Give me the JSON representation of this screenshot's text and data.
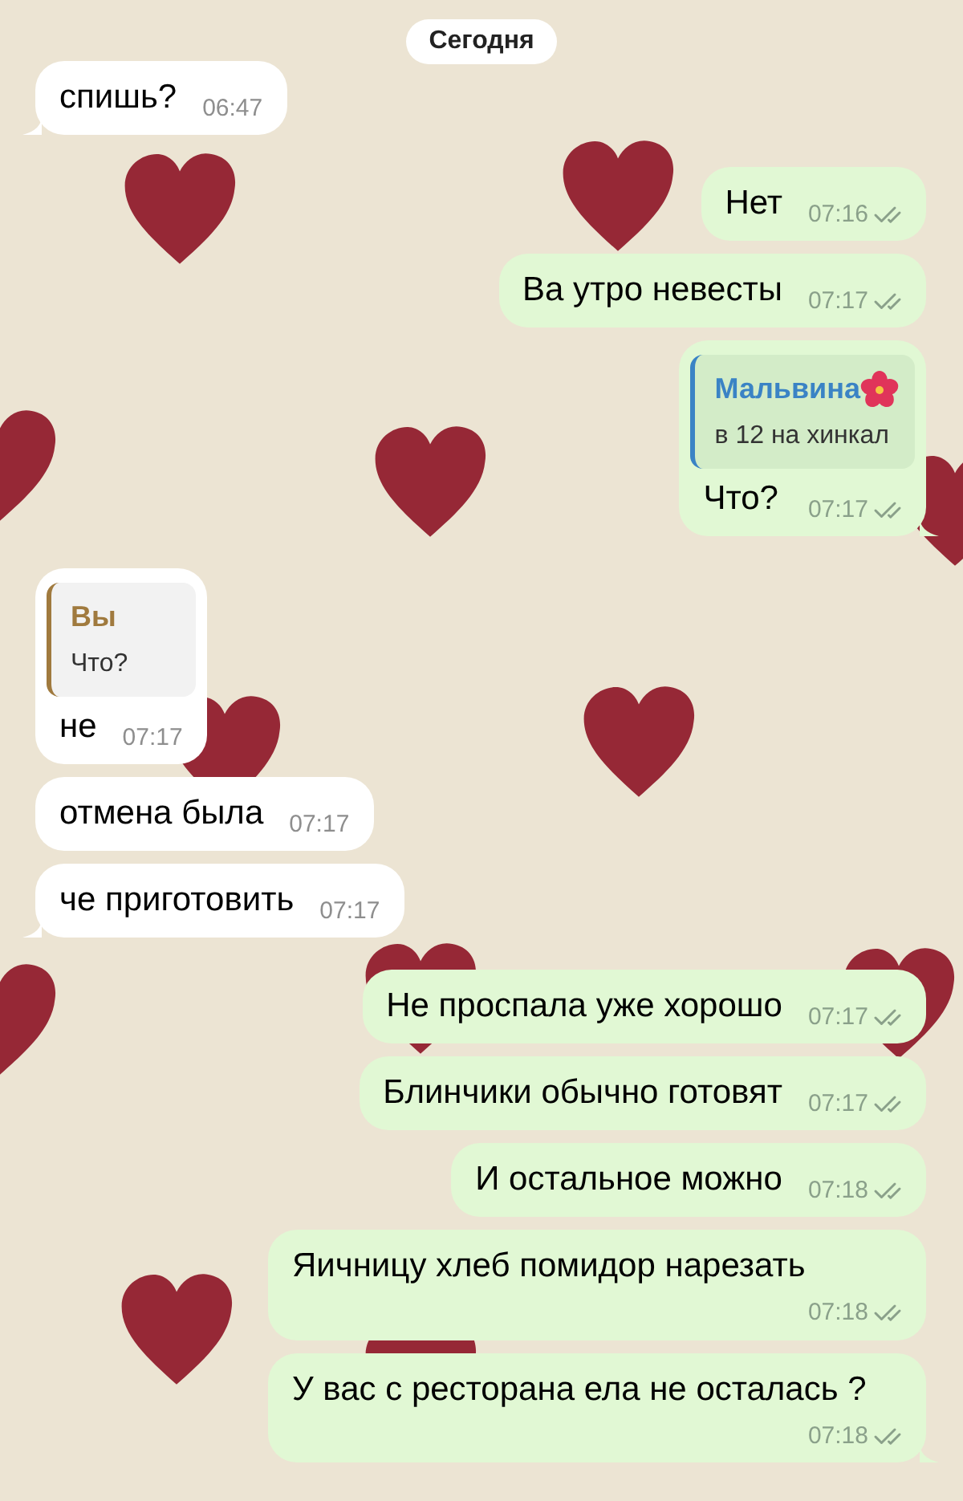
{
  "date_pill": "Сегодня",
  "messages": [
    {
      "kind": "incoming",
      "text": "спишь?",
      "time": "06:47",
      "tail": true
    },
    {
      "kind": "outgoing",
      "text": "Нет",
      "time": "07:16",
      "read": true,
      "tail": false
    },
    {
      "kind": "outgoing",
      "text": "Ва утро невесты",
      "time": "07:17",
      "read": true,
      "tail": false
    },
    {
      "kind": "outgoing",
      "text": "Что?",
      "time": "07:17",
      "read": true,
      "tail": true,
      "reply": {
        "author": "Мальвина",
        "author_badge": true,
        "text": "в 12 на хинкал"
      }
    },
    {
      "kind": "incoming",
      "text": "не",
      "time": "07:17",
      "tail": false,
      "reply": {
        "author": "Вы",
        "text": "Что?"
      }
    },
    {
      "kind": "incoming",
      "text": "отмена была",
      "time": "07:17",
      "tail": false
    },
    {
      "kind": "incoming",
      "text": "че приготовить",
      "time": "07:17",
      "tail": true
    },
    {
      "kind": "outgoing",
      "text": "Не проспала уже хорошо",
      "time": "07:17",
      "read": true,
      "tail": false
    },
    {
      "kind": "outgoing",
      "text": "Блинчики обычно готовят",
      "time": "07:17",
      "read": true,
      "tail": false
    },
    {
      "kind": "outgoing",
      "text": "И остальное можно",
      "time": "07:18",
      "read": true,
      "tail": false
    },
    {
      "kind": "outgoing",
      "text": "Яичницу хлеб помидор нарезать",
      "time": "07:18",
      "read": true,
      "tail": false
    },
    {
      "kind": "outgoing",
      "text": "У вас с ресторана ела не осталась ?",
      "time": "07:18",
      "read": true,
      "tail": true
    }
  ]
}
